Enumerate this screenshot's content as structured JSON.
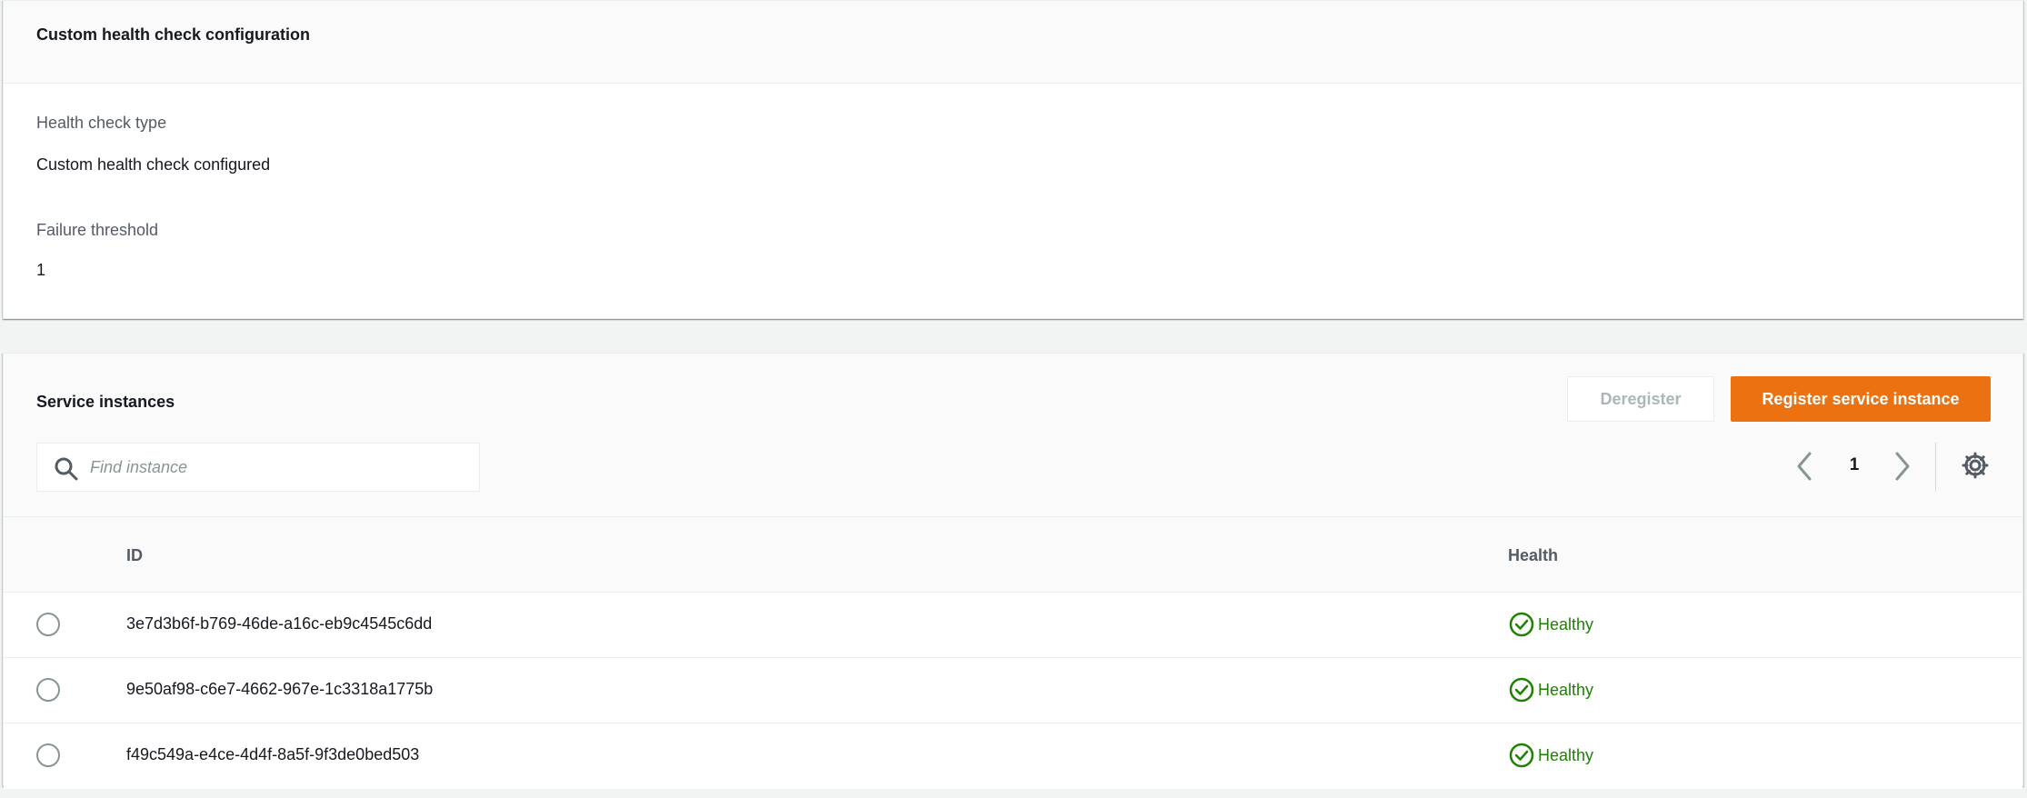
{
  "config_panel": {
    "title": "Custom health check configuration",
    "health_check_type_label": "Health check type",
    "health_check_type_value": "Custom health check configured",
    "failure_threshold_label": "Failure threshold",
    "failure_threshold_value": "1"
  },
  "instances_panel": {
    "title": "Service instances",
    "deregister_label": "Deregister",
    "register_label": "Register service instance",
    "search": {
      "placeholder": "Find instance",
      "value": ""
    },
    "pagination": {
      "current_page": "1"
    },
    "columns": {
      "id": "ID",
      "health": "Health"
    },
    "rows": [
      {
        "id": "3e7d3b6f-b769-46de-a16c-eb9c4545c6dd",
        "health": "Healthy"
      },
      {
        "id": "9e50af98-c6e7-4662-967e-1c3318a1775b",
        "health": "Healthy"
      },
      {
        "id": "f49c549a-e4ce-4d4f-8a5f-9f3de0bed503",
        "health": "Healthy"
      }
    ]
  },
  "colors": {
    "accent": "#ec7211",
    "healthy": "#1d8102",
    "text": "#16191f",
    "muted": "#545b64"
  },
  "icons": {
    "search": "search-icon",
    "prev": "chevron-left-icon",
    "next": "chevron-right-icon",
    "settings": "gear-icon",
    "status": "check-circle-icon"
  }
}
